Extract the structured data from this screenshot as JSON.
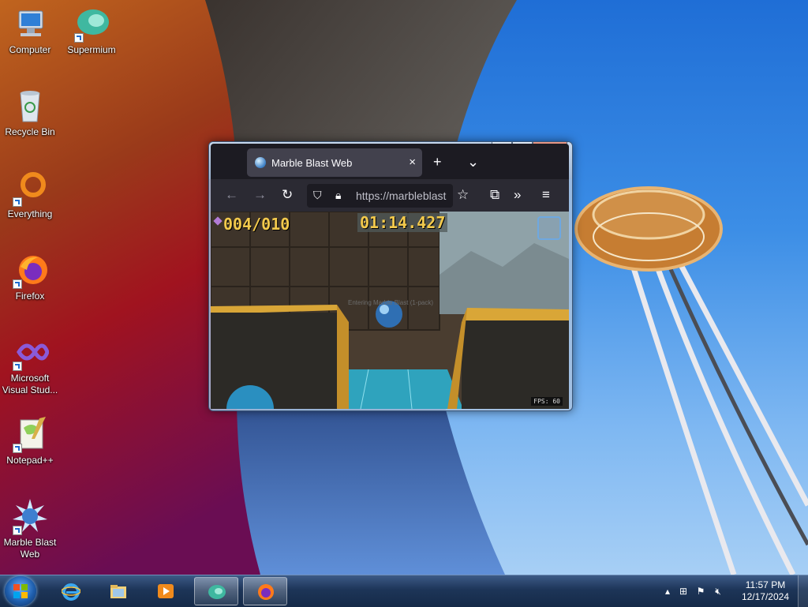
{
  "desktop": {
    "icons": [
      {
        "label": "Computer",
        "icon": "computer-icon"
      },
      {
        "label": "Supermium",
        "icon": "supermium-icon"
      },
      {
        "label": "Recycle Bin",
        "icon": "recycle-bin-icon"
      },
      {
        "label": "Everything",
        "icon": "everything-icon"
      },
      {
        "label": "Firefox",
        "icon": "firefox-icon"
      },
      {
        "label": "Microsoft Visual Stud...",
        "icon": "visual-studio-icon"
      },
      {
        "label": "Notepad++",
        "icon": "notepadpp-icon"
      },
      {
        "label": "Marble Blast Web",
        "icon": "marble-blast-icon"
      }
    ]
  },
  "browser": {
    "tab_title": "Marble Blast Web",
    "url": "https://marbleblast",
    "new_tab": "+",
    "list_tabs": "⌄",
    "back": "←",
    "forward": "→",
    "reload": "↻",
    "bookmark": "☆",
    "extensions": "⧉",
    "overflow": "»",
    "menu": "≡"
  },
  "game": {
    "gems": "004/010",
    "timer": "01:14.427",
    "help_text": "Entering Marble Blast (1-pack)",
    "fps": "FPS: 60"
  },
  "taskbar": {
    "time": "11:57 PM",
    "date": "12/17/2024",
    "tray_arrow": "▴"
  },
  "colors": {
    "taskbar": "#1d3558",
    "tab_bg": "#42414d",
    "toolbar_bg": "#2b2a33",
    "hud_text": "#f2c94c"
  }
}
